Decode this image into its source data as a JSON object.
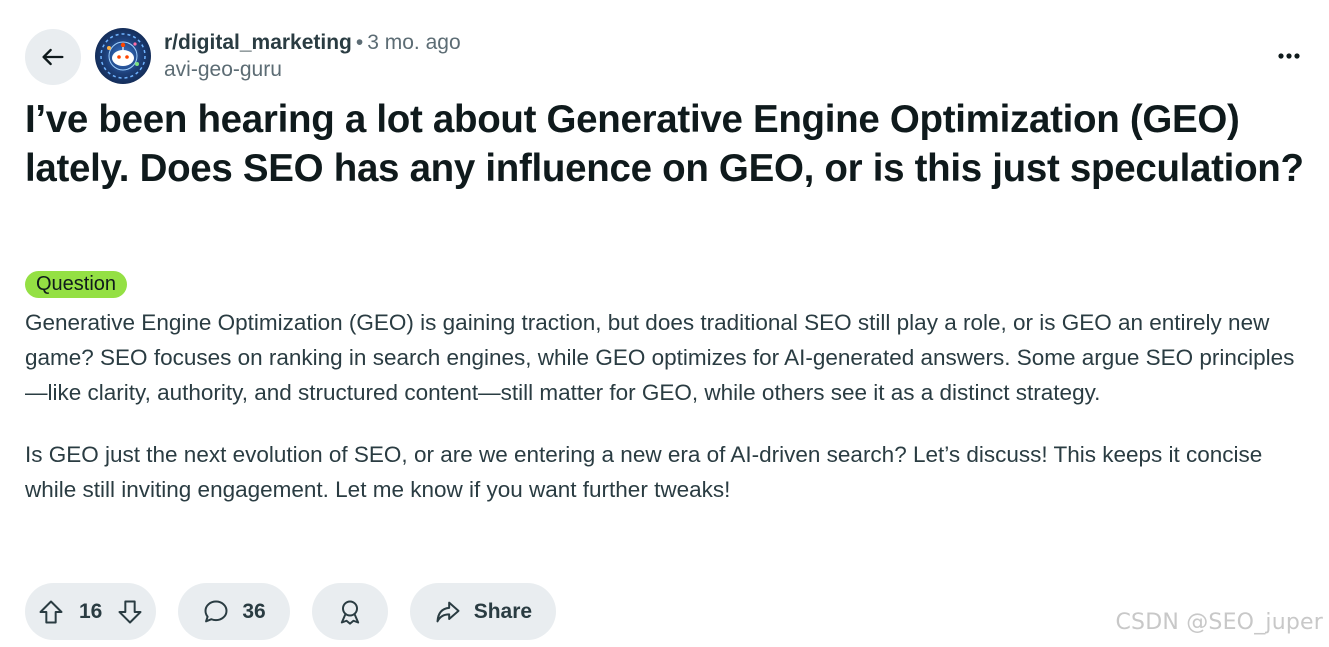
{
  "header": {
    "subreddit": "r/digital_marketing",
    "separator": "•",
    "time": "3 mo. ago",
    "author": "avi-geo-guru"
  },
  "post": {
    "title": "I’ve been hearing a lot about Generative Engine Optimization (GEO) lately. Does SEO has any influence on GEO, or is this just speculation?",
    "flair": "Question",
    "paragraphs": [
      "Generative Engine Optimization (GEO) is gaining traction, but does traditional SEO still play a role, or is GEO an entirely new game? SEO focuses on ranking in search engines, while GEO optimizes for AI-generated answers. Some argue SEO principles—like clarity, authority, and structured content—still matter for GEO, while others see it as a distinct strategy.",
      "Is GEO just the next evolution of SEO, or are we entering a new era of AI-driven search? Let’s discuss! This keeps it concise while still inviting engagement. Let me know if you want further tweaks!"
    ]
  },
  "actions": {
    "votes": "16",
    "comments": "36",
    "share_label": "Share"
  },
  "icons": [
    "back-arrow-icon",
    "more-options-icon",
    "upvote-icon",
    "downvote-icon",
    "comment-icon",
    "award-icon",
    "share-icon"
  ],
  "colors": {
    "flair_bg": "#94e044",
    "pill_bg": "#e9edf0",
    "text": "#0f1a1c",
    "muted": "#5c6c74"
  },
  "watermark": "CSDN @SEO_juper"
}
